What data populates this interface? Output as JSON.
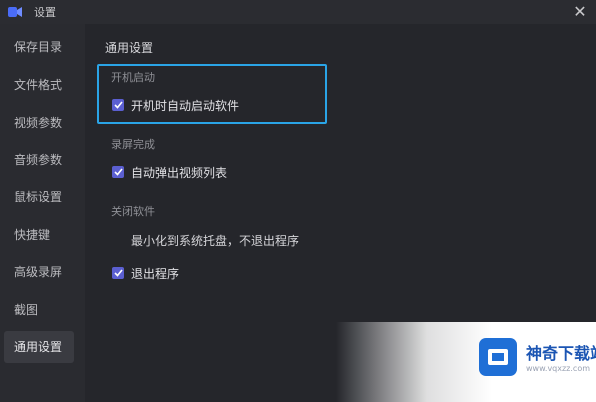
{
  "window": {
    "title": "设置",
    "close_glyph": "✕"
  },
  "sidebar": {
    "items": [
      {
        "label": "保存目录"
      },
      {
        "label": "文件格式"
      },
      {
        "label": "视频参数"
      },
      {
        "label": "音频参数"
      },
      {
        "label": "鼠标设置"
      },
      {
        "label": "快捷键"
      },
      {
        "label": "高级录屏"
      },
      {
        "label": "截图"
      },
      {
        "label": "通用设置",
        "active": true
      }
    ]
  },
  "main": {
    "heading": "通用设置",
    "startup": {
      "label": "开机启动",
      "option": {
        "text": "开机时自动启动软件",
        "checked": true
      }
    },
    "record_done": {
      "label": "录屏完成",
      "option": {
        "text": "自动弹出视频列表",
        "checked": true
      }
    },
    "close_app": {
      "label": "关闭软件",
      "minimize_text": "最小化到系统托盘，不退出程序",
      "exit_option": {
        "text": "退出程序",
        "checked": true
      }
    }
  },
  "watermark": {
    "title": "神奇下载站",
    "url": "www.vqxzz.com"
  },
  "colors": {
    "accent_checkbox": "#5b5fd1",
    "focus_border": "#2aa4e6",
    "background": "#25262b",
    "sidebar": "#2a2b30"
  }
}
